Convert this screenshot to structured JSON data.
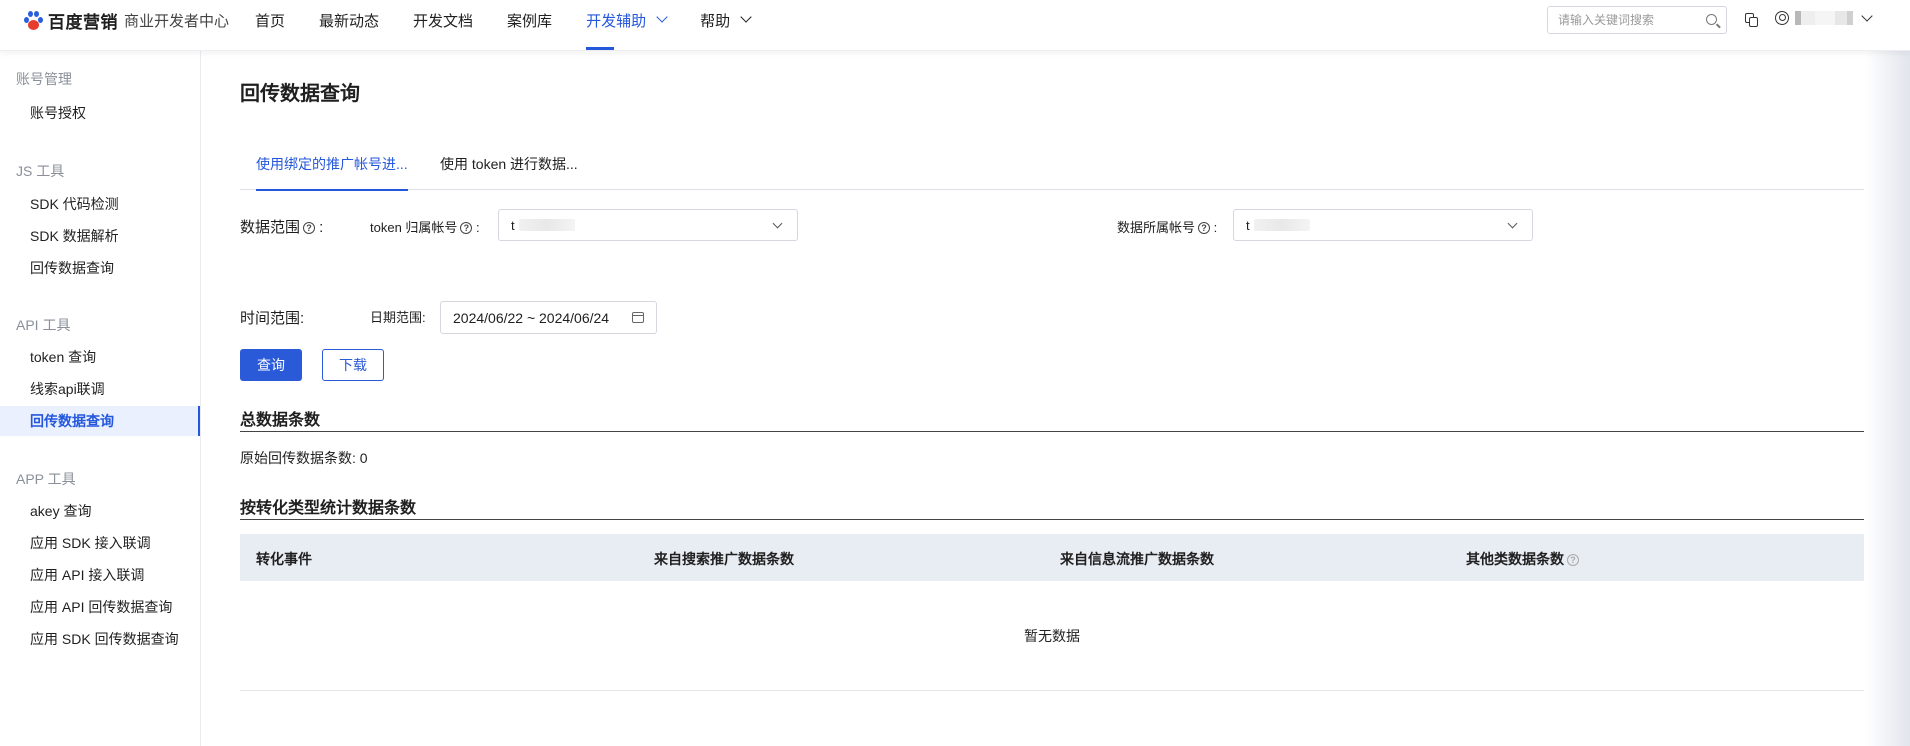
{
  "header": {
    "brand": "百度营销",
    "subtitle": "商业开发者中心",
    "nav": [
      {
        "label": "首页"
      },
      {
        "label": "最新动态"
      },
      {
        "label": "开发文档"
      },
      {
        "label": "案例库"
      },
      {
        "label": "开发辅助",
        "dropdown": true,
        "active": true
      },
      {
        "label": "帮助",
        "dropdown": true
      }
    ],
    "search_placeholder": "请输入关键词搜索",
    "icons": {
      "search": "search-icon",
      "copy": "copy-icon",
      "user": "user-icon"
    },
    "accent_color": "#2457dc"
  },
  "sidebar": {
    "groups": [
      {
        "title": "账号管理",
        "items": [
          "账号授权"
        ]
      },
      {
        "title": "JS 工具",
        "items": [
          "SDK 代码检测",
          "SDK 数据解析",
          "回传数据查询"
        ]
      },
      {
        "title": "API 工具",
        "items": [
          "token 查询",
          "线索api联调",
          "回传数据查询"
        ]
      },
      {
        "title": "APP 工具",
        "items": [
          "akey 查询",
          "应用 SDK 接入联调",
          "应用 API 接入联调",
          "应用 API 回传数据查询",
          "应用 SDK 回传数据查询"
        ]
      }
    ],
    "active_item": "回传数据查询"
  },
  "main": {
    "title": "回传数据查询",
    "tabs": [
      "使用绑定的推广帐号进...",
      "使用 token 进行数据..."
    ],
    "data_range": {
      "label": "数据范围",
      "token_account_label": "token 归属帐号",
      "token_account_value": "t",
      "data_account_label": "数据所属帐号",
      "data_account_value": "t"
    },
    "time_range": {
      "label": "时间范围:",
      "date_label": "日期范围:",
      "date_value": "2024/06/22 ~ 2024/06/24"
    },
    "buttons": {
      "query": "查询",
      "download": "下载"
    },
    "total": {
      "title": "总数据条数",
      "raw_label": "原始回传数据条数:",
      "raw_value": "0"
    },
    "by_type": {
      "title": "按转化类型统计数据条数",
      "columns": [
        "转化事件",
        "来自搜索推广数据条数",
        "来自信息流推广数据条数",
        "其他类数据条数"
      ],
      "empty_text": "暂无数据"
    }
  }
}
